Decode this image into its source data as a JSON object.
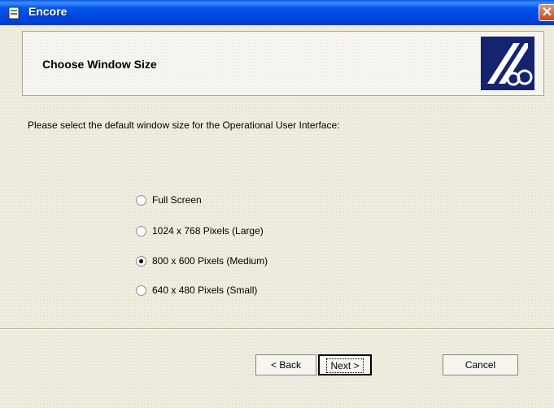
{
  "window": {
    "title": "Encore",
    "close_symbol": "✕"
  },
  "header": {
    "title": "Choose Window Size"
  },
  "instruction": "Please select the default window size for the Operational User Interface:",
  "options": [
    {
      "label": "Full Screen",
      "selected": false
    },
    {
      "label": "1024 x 768 Pixels (Large)",
      "selected": false
    },
    {
      "label": "800 x 600 Pixels (Medium)",
      "selected": true
    },
    {
      "label": "640 x 480 Pixels (Small)",
      "selected": false
    }
  ],
  "buttons": {
    "back": "< Back",
    "next": "Next >",
    "cancel": "Cancel"
  },
  "colors": {
    "titlebar": "#0054E3",
    "logo_bg": "#14246E",
    "face": "#ECE9D8"
  }
}
